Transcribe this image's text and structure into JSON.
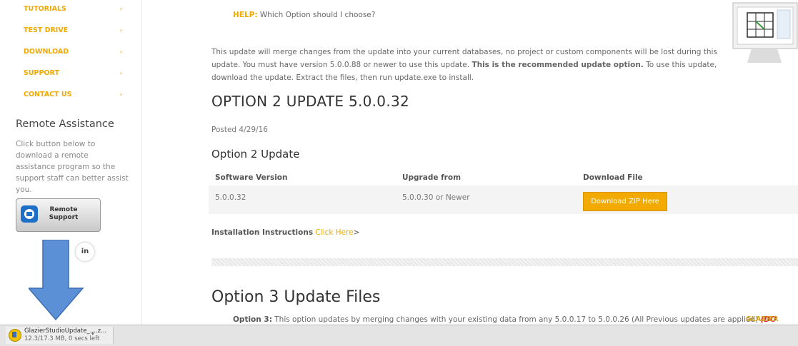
{
  "sidebar": {
    "nav": [
      {
        "label": "TUTORIALS",
        "arrow": "›"
      },
      {
        "label": "TEST DRIVE",
        "arrow": "›"
      },
      {
        "label": "DOWNLOAD",
        "arrow": "›"
      },
      {
        "label": "SUPPORT",
        "arrow": "›"
      },
      {
        "label": "CONTACT US",
        "arrow": "›"
      }
    ],
    "remote_title": "Remote Assistance",
    "remote_text": "Click button below to download a remote assistance program so the support staff can better assist you.",
    "remote_button": {
      "line1": "Remote",
      "line2": "Support",
      "icon": "teamviewer-icon"
    },
    "linkedin": "in"
  },
  "help": {
    "label": "HELP:",
    "text": " Which Option should I choose?"
  },
  "description": {
    "part1": "This update will merge changes from the update into your current databases, no project or custom components will be lost during this update. You must have version 5.0.0.88 or newer to use this update. ",
    "bold": "This is the recommended update option.",
    "part2": " To use this update, download the update. Extract the files, then run update.exe to install."
  },
  "option2": {
    "heading": "OPTION 2 UPDATE 5.0.0.32",
    "posted": "Posted 4/29/16",
    "subheading": "Option 2 Update",
    "columns": [
      "Software Version",
      "Upgrade from",
      "Download File"
    ],
    "row": {
      "version": "5.0.0.32",
      "upgrade_from": "5.0.0.30 or Newer",
      "download_label": "Download ZIP Here"
    }
  },
  "install": {
    "label": "Installation Instructions",
    "link": "Click Here",
    "suffix": ">"
  },
  "option3": {
    "heading": "Option 3 Update Files",
    "label": "Option 3:",
    "text": " This option updates by merging changes with your existing data from any 5.0.0.17 to 5.0.0.26 (All Previous updates are applied) ",
    "warn": "(DO",
    "brand": "GLAZIER"
  },
  "download_bar": {
    "filename": "GlazierStudioUpdate_....z...",
    "status": "12.3/17.3 MB, 0 secs left",
    "menu": "▾"
  },
  "colors": {
    "accent": "#f2a900",
    "arrow": "#5b8fd6",
    "warn": "#d92a2a"
  }
}
